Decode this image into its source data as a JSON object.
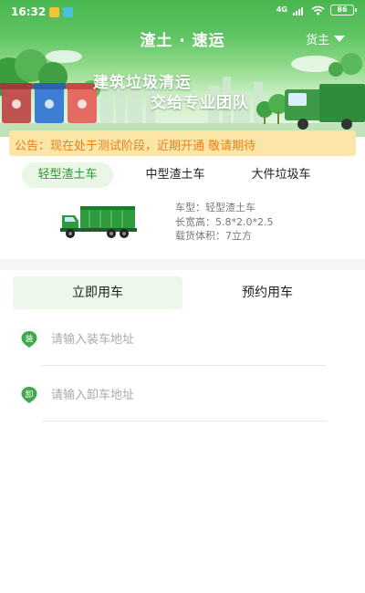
{
  "status_bar": {
    "time": "16:32",
    "network": "4G",
    "battery": "86"
  },
  "header": {
    "title": "渣土 · 速运",
    "role_selector": "货主"
  },
  "banner": {
    "line1": "建筑垃圾清运",
    "line2": "交给专业团队"
  },
  "notice": {
    "text": "公告：现在处于测试阶段，近期开通  敬请期待"
  },
  "vehicle_types": {
    "tabs": [
      {
        "label": "轻型渣土车",
        "active": true
      },
      {
        "label": "中型渣土车",
        "active": false
      },
      {
        "label": "大件垃圾车",
        "active": false
      }
    ],
    "selected_info": {
      "model": "车型：轻型渣土车",
      "dimensions": "长宽高：5.8*2.0*2.5",
      "volume": "载货体积：7立方"
    }
  },
  "order": {
    "tabs": [
      {
        "label": "立即用车",
        "active": true
      },
      {
        "label": "预约用车",
        "active": false
      }
    ],
    "load_address": {
      "badge": "装",
      "placeholder": "请输入装车地址"
    },
    "unload_address": {
      "badge": "卸",
      "placeholder": "请输入卸车地址"
    }
  },
  "colors": {
    "brand_green": "#49b64f",
    "notice_bg": "#fbe6a8",
    "notice_text": "#e8801c",
    "active_tab_bg": "#eef7ec"
  }
}
